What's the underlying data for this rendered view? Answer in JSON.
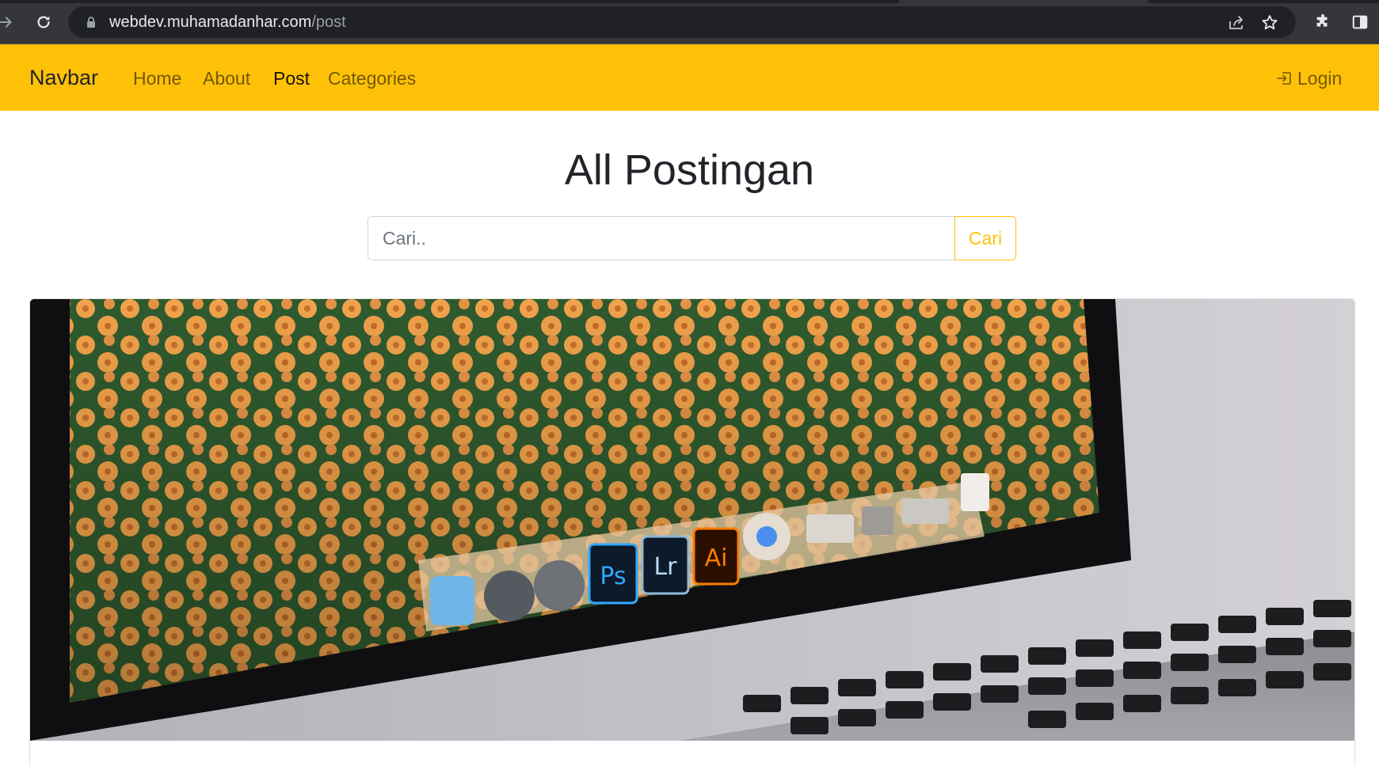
{
  "browser": {
    "url_host": "webdev.muhamadanhar.com",
    "url_path": "/post",
    "icons": [
      "forward-icon",
      "reload-icon",
      "lock-icon",
      "share-icon",
      "bookmark-star-icon",
      "extensions-icon",
      "side-panel-icon"
    ]
  },
  "navbar": {
    "brand": "Navbar",
    "links": [
      {
        "label": "Home",
        "active": false
      },
      {
        "label": "About",
        "active": false
      },
      {
        "label": "Post",
        "active": true
      },
      {
        "label": "Categories",
        "active": false
      }
    ],
    "login_label": "Login"
  },
  "main": {
    "title": "All Postingan",
    "search": {
      "placeholder": "Cari..",
      "button_label": "Cari"
    }
  },
  "colors": {
    "navbar_bg": "#ffc107",
    "accent": "#ffc107",
    "text": "#212529",
    "chrome_bg": "#35363a"
  }
}
